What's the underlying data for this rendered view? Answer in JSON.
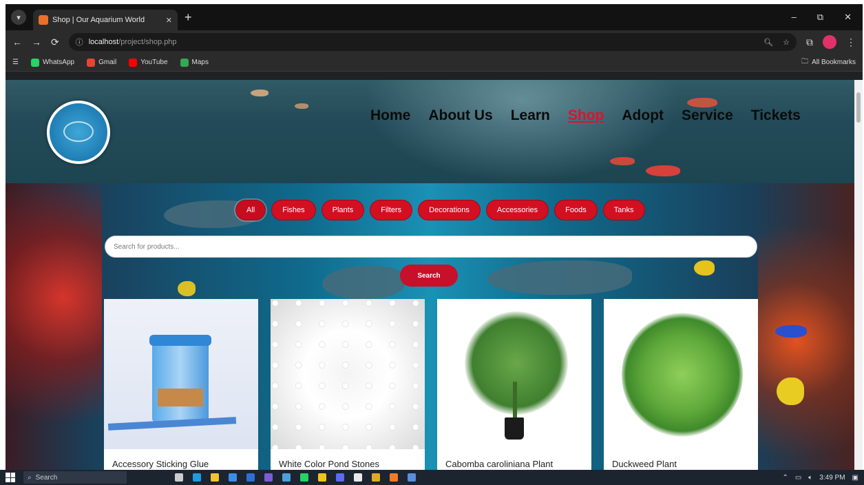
{
  "browser": {
    "tab_title": "Shop | Our Aquarium World",
    "new_tab_symbol": "+",
    "url_host": "localhost",
    "url_path": "/project/shop.php",
    "window_controls": [
      "–",
      "⧉",
      "✕"
    ]
  },
  "bookmarks": [
    {
      "label": "WhatsApp",
      "color": "#25d366"
    },
    {
      "label": "Gmail",
      "color": "#ea4335"
    },
    {
      "label": "YouTube",
      "color": "#ff0000"
    },
    {
      "label": "Maps",
      "color": "#34a853"
    }
  ],
  "all_bookmarks_label": "All Bookmarks",
  "nav": {
    "items": [
      "Home",
      "About Us",
      "Learn",
      "Shop",
      "Adopt",
      "Service",
      "Tickets"
    ],
    "active": "Shop"
  },
  "categories": [
    "All",
    "Fishes",
    "Plants",
    "Filters",
    "Decorations",
    "Accessories",
    "Foods",
    "Tanks"
  ],
  "search": {
    "placeholder": "Search for products...",
    "button_label": "Search"
  },
  "products": [
    {
      "name": "Accessory Sticking Glue",
      "icon": "glue-jar"
    },
    {
      "name": "White Color Pond Stones",
      "icon": "white-stones"
    },
    {
      "name": "Cabomba caroliniana Plant",
      "icon": "potted-plant"
    },
    {
      "name": "Duckweed Plant",
      "icon": "leafy-plant"
    }
  ],
  "taskbar": {
    "search_label": "Search",
    "time": "3:49 PM"
  },
  "colors": {
    "accent_red": "#d30f22",
    "nav_active": "#e0112b"
  }
}
